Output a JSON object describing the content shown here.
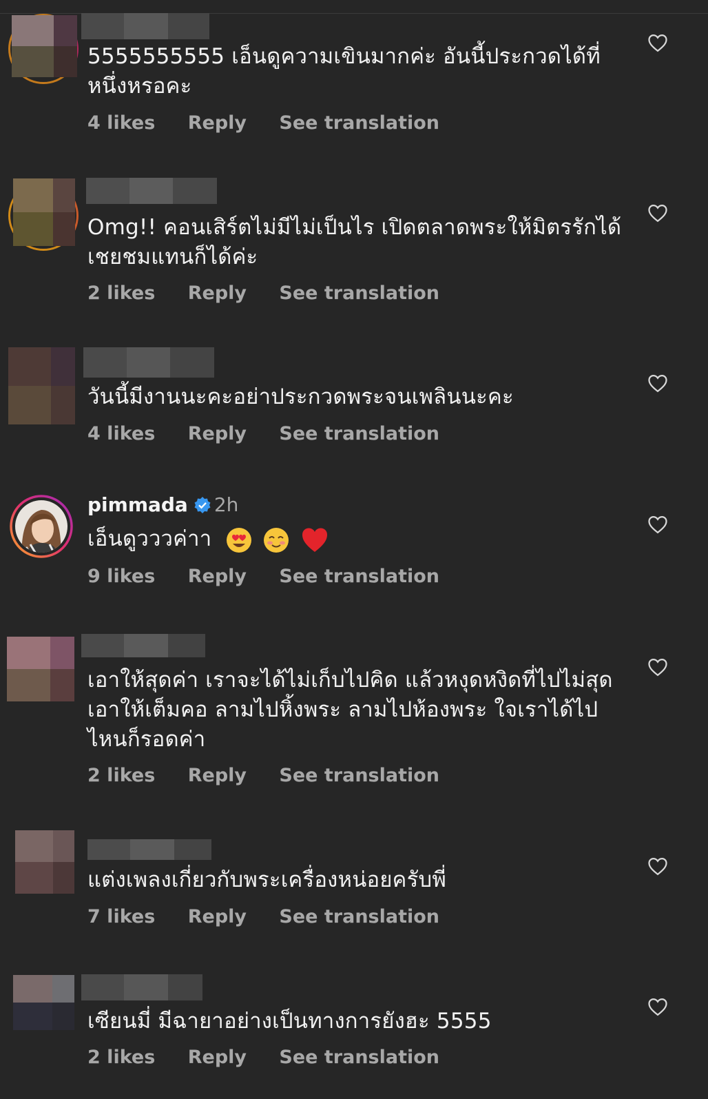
{
  "comments": [
    {
      "text": "5555555555 เอ็นดูความเขินมากค่ะ อันนี้ประกวดได้ที่หนึ่งหรอคะ",
      "likes": "4 likes",
      "reply": "Reply",
      "see_translation": "See translation"
    },
    {
      "text": "Omg!! คอนเสิร์ตไม่มีไม่เป็นไร เปิดตลาดพระให้มิตรรักได้เชยชมแทนก็ได้ค่ะ",
      "likes": "2 likes",
      "reply": "Reply",
      "see_translation": "See translation"
    },
    {
      "text": "วันนี้มีงานนะคะอย่าประกวดพระจนเพลินนะคะ",
      "likes": "4 likes",
      "reply": "Reply",
      "see_translation": "See translation"
    },
    {
      "username": "pimmada",
      "time": "2h",
      "text": "เอ็นดูวววค่าา",
      "likes": "9 likes",
      "reply": "Reply",
      "see_translation": "See translation"
    },
    {
      "text": "เอาให้สุดค่า เราจะได้ไม่เก็บไปคิด แล้วหงุดหงิดที่ไปไม่สุด เอาให้เต็มคอ ลามไปหิ้งพระ ลามไปห้องพระ ใจเราได้ไปไหนก็รอดค่า",
      "likes": "2 likes",
      "reply": "Reply",
      "see_translation": "See translation"
    },
    {
      "text": "แต่งเพลงเกี่ยวกับพระเครื่องหน่อยครับพี่",
      "likes": "7 likes",
      "reply": "Reply",
      "see_translation": "See translation"
    },
    {
      "text": "เซียนมี่ มีฉายาอย่างเป็นทางการยังฮะ 5555",
      "likes": "2 likes",
      "reply": "Reply",
      "see_translation": "See translation"
    }
  ],
  "icons": {
    "like": "heart-outline-icon",
    "verified": "verified-badge-icon"
  },
  "colors": {
    "background": "#262626",
    "secondary_text": "#a8a8a8",
    "verified_blue": "#3897f0"
  }
}
